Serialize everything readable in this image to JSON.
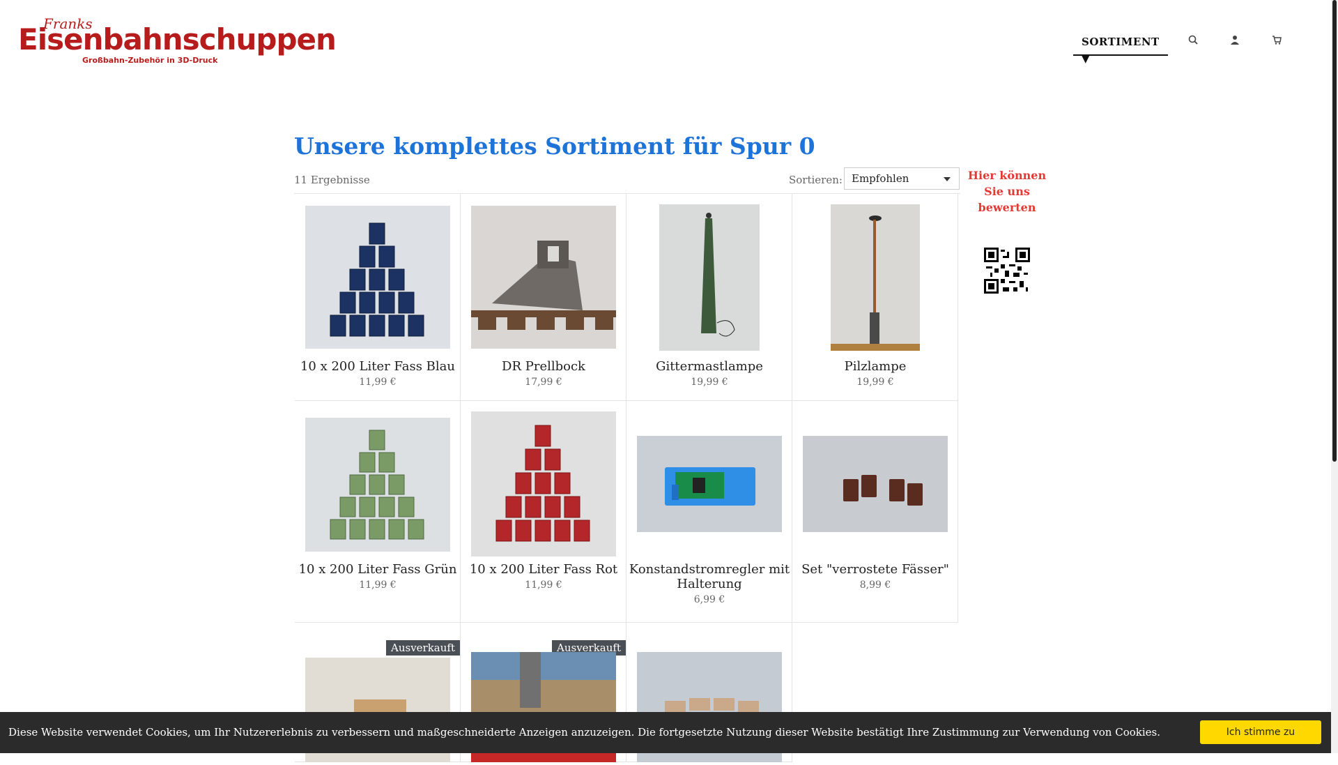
{
  "brand": {
    "franks": "Franks",
    "name": "Eisenbahnschuppen",
    "tagline": "Großbahn-Zubehör in 3D-Druck"
  },
  "nav": {
    "sortiment": "SORTIMENT ▼",
    "icons": [
      "search-icon",
      "user-icon",
      "cart-icon"
    ]
  },
  "page": {
    "title": "Unsere komplettes Sortiment für Spur 0",
    "results": "11 Ergebnisse",
    "sort_label": "Sortieren:",
    "sort_value": "Empfohlen"
  },
  "products": [
    {
      "name": "10 x 200 Liter Fass Blau",
      "price": "11,99 €"
    },
    {
      "name": "DR Prellbock",
      "price": "17,99 €"
    },
    {
      "name": "Gittermastlampe",
      "price": "19,99 €"
    },
    {
      "name": "Pilzlampe",
      "price": "19,99 €"
    },
    {
      "name": "10 x 200 Liter Fass Grün",
      "price": "11,99 €"
    },
    {
      "name": "10 x 200 Liter Fass Rot",
      "price": "11,99 €"
    },
    {
      "name": "Konstandstromregler mit Halterung",
      "price": "6,99 €"
    },
    {
      "name": "Set \"verrostete Fässer\"",
      "price": "8,99 €"
    },
    {
      "badge": "Ausverkauft"
    },
    {
      "badge": "Ausverkauft"
    },
    {}
  ],
  "sidebar": {
    "rate_text": "Hier können Sie uns bewerten"
  },
  "cookie": {
    "text": "Diese Website verwendet Cookies, um Ihr Nutzererlebnis zu verbessern und maßgeschneiderte Anzeigen anzuzeigen. Die fortgesetzte Nutzung dieser Website bestätigt Ihre Zustimmung zur Verwendung von Cookies.",
    "button": "Ich stimme zu"
  },
  "colors": {
    "brand_red": "#b71c1c",
    "title_blue": "#1e73d9",
    "rate_red": "#e53935",
    "cookie_button": "#ffd800"
  }
}
